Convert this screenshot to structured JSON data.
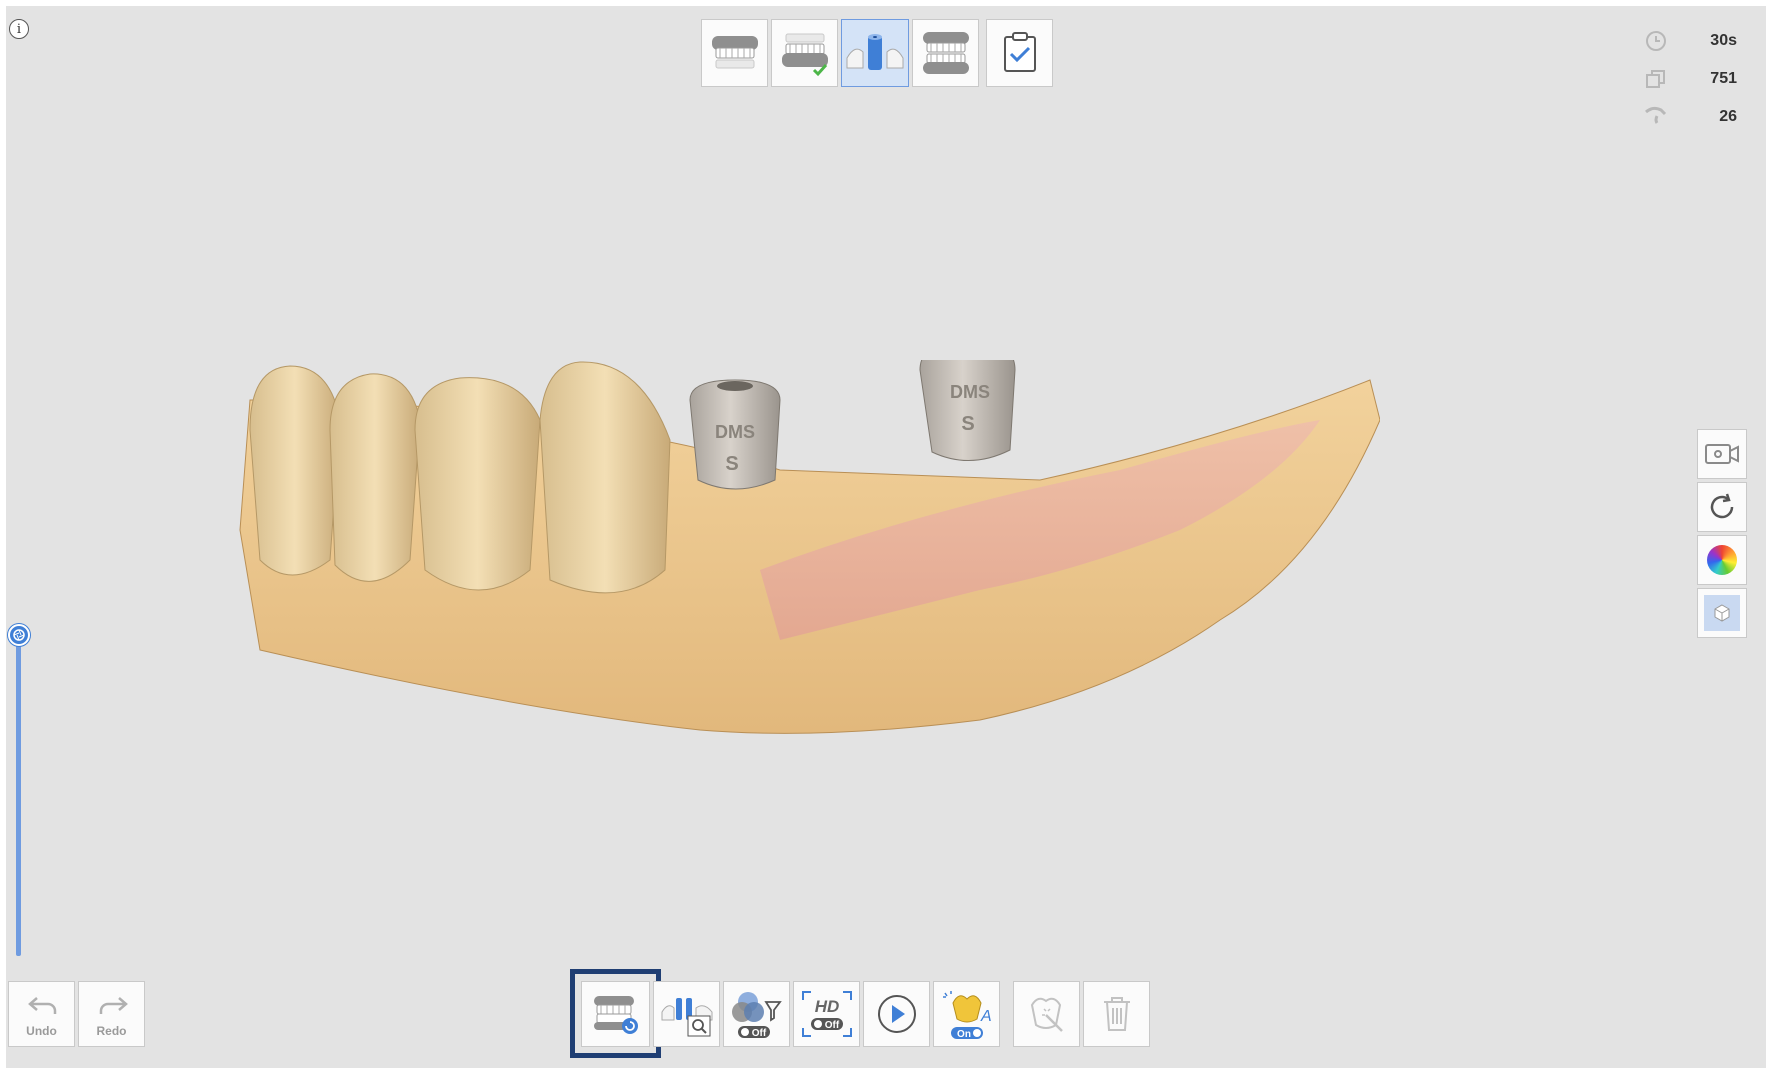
{
  "info_icon": "i",
  "stages": [
    {
      "name": "maxilla-stage",
      "icon": "upper-jaw-icon"
    },
    {
      "name": "mandible-stage",
      "icon": "lower-jaw-check-icon",
      "completed": true
    },
    {
      "name": "scanbody-stage",
      "icon": "scanbody-icon",
      "active": true
    },
    {
      "name": "occlusion-stage",
      "icon": "occlusion-icon"
    },
    {
      "name": "review-stage",
      "icon": "clipboard-check-icon"
    }
  ],
  "stats": {
    "time": "30s",
    "shots": "751",
    "count": "26"
  },
  "toolbar": {
    "undo_label": "Undo",
    "redo_label": "Redo",
    "filter_state": "Off",
    "hd_label": "HD",
    "hd_state": "Off",
    "auto_state": "On"
  },
  "scanbody_labels": {
    "left_top": "DMS",
    "left_bottom": "S",
    "right_top": "DMS",
    "right_bottom": "S"
  },
  "colors": {
    "accent": "#4a86dc",
    "highlight_box": "#1f3e73",
    "background": "#e3e3e3",
    "check_green": "#4cb648"
  }
}
